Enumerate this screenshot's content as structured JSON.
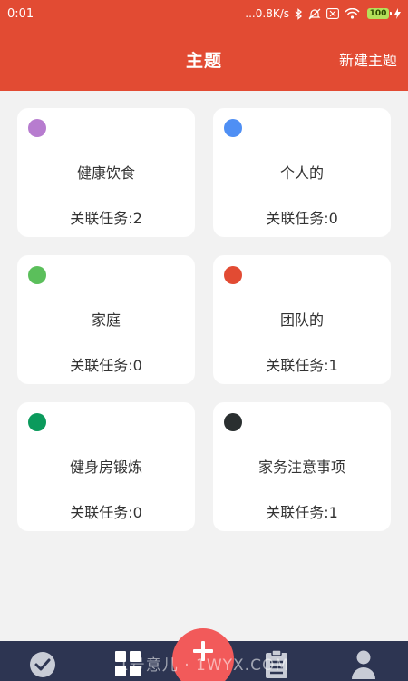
{
  "status_bar": {
    "time": "0:01",
    "network_speed": "...0.8K/s",
    "battery_level": "100",
    "icons": [
      "bluetooth-icon",
      "mute-icon",
      "sim-icon",
      "wifi-icon",
      "battery-icon",
      "charging-icon"
    ]
  },
  "header": {
    "title": "主题",
    "new_topic_label": "新建主题",
    "background_color": "#e24b33"
  },
  "topics": [
    {
      "name": "健康饮食",
      "count_text": "关联任务:2",
      "color": "#b77ccf"
    },
    {
      "name": "个人的",
      "count_text": "关联任务:0",
      "color": "#4f8ff4"
    },
    {
      "name": "家庭",
      "count_text": "关联任务:0",
      "color": "#5bbf5b"
    },
    {
      "name": "团队的",
      "count_text": "关联任务:1",
      "color": "#e24b33"
    },
    {
      "name": "健身房锻炼",
      "count_text": "关联任务:0",
      "color": "#0b9a5c"
    },
    {
      "name": "家务注意事项",
      "count_text": "关联任务:1",
      "color": "#2a2f30"
    }
  ],
  "bottom_nav": {
    "background_color": "#2d3552",
    "fab_color": "#f25a5a",
    "items": [
      "check-circle-icon",
      "grid-icon",
      "add-icon",
      "clipboard-list-icon",
      "person-icon"
    ]
  },
  "watermark": "1号意儿 · 1WYX.COM"
}
